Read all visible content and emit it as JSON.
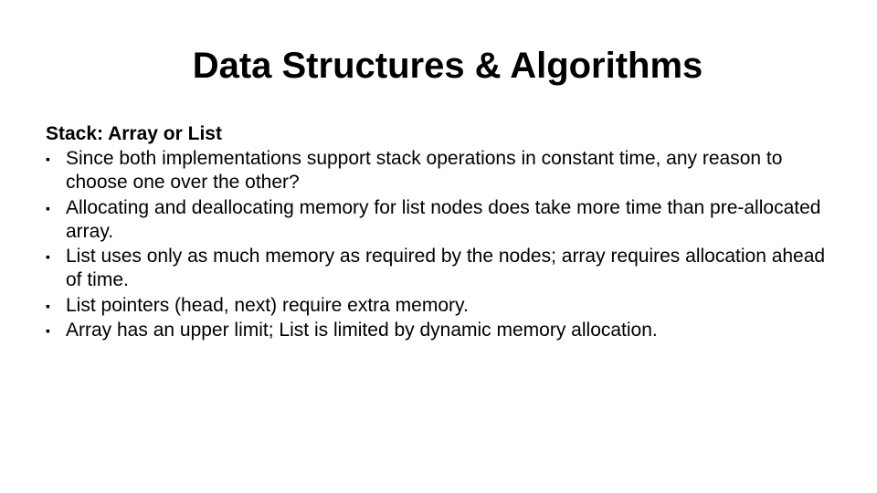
{
  "title": "Data Structures & Algorithms",
  "subtitle": "Stack: Array or List",
  "bullets": [
    "Since both implementations support stack operations in constant time, any reason to choose one over the other?",
    "Allocating and deallocating memory for list nodes does take more time than pre-allocated array.",
    "List uses only as much memory as required by the nodes; array requires allocation ahead of time.",
    "List pointers (head, next) require extra memory.",
    "Array has an upper limit; List is limited by dynamic memory allocation."
  ]
}
